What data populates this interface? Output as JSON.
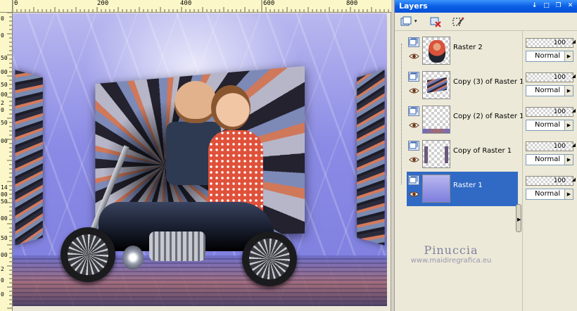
{
  "ruler": {
    "top_labels": [
      "0",
      "200",
      "400",
      "600",
      "800"
    ],
    "left_labels": [
      "0",
      "0",
      "50",
      "00",
      "50",
      "00",
      "2",
      "0",
      "50",
      "00",
      "14",
      "00",
      "50",
      "00",
      "50",
      "00",
      "2",
      "0",
      "0"
    ]
  },
  "watermark": {
    "title": "Pinuccia",
    "url": "www.maidiregrafica.eu"
  },
  "layers_palette": {
    "title": "Layers",
    "title_buttons": [
      "↓",
      "□",
      "❐",
      "✕"
    ],
    "toolbar": [
      "new-layer",
      "delete-layer",
      "edit-selection"
    ],
    "layers": [
      {
        "name": "Raster 2",
        "opacity": "100",
        "blend": "Normal",
        "selected": false
      },
      {
        "name": "Copy (3) of Raster 1",
        "opacity": "100",
        "blend": "Normal",
        "selected": false
      },
      {
        "name": "Copy (2) of Raster 1",
        "opacity": "100",
        "blend": "Normal",
        "selected": false
      },
      {
        "name": "Copy of Raster 1",
        "opacity": "100",
        "blend": "Normal",
        "selected": false
      },
      {
        "name": "Raster 1",
        "opacity": "100",
        "blend": "Normal",
        "selected": true
      }
    ]
  },
  "colors": {
    "title_bar": "#0a5fe4",
    "selected_row": "#316ac5",
    "panel_bg": "#ece9d8",
    "ruler_bg": "#fbf7c8"
  }
}
